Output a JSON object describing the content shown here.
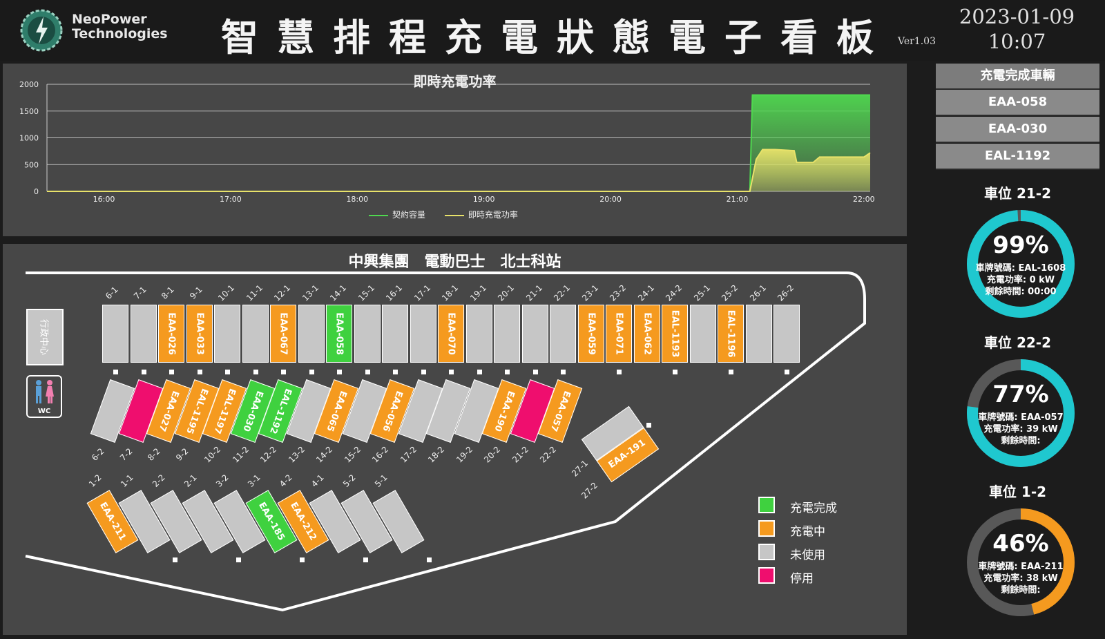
{
  "header": {
    "company_line1": "NeoPower",
    "company_line2": "Technologies",
    "title": "智慧排程充電狀態電子看板",
    "version": "Ver1.03",
    "date": "2023-01-09",
    "time": "10:07"
  },
  "chart_data": {
    "type": "area",
    "title": "即時充電功率",
    "x_ticks": [
      "16:00",
      "17:00",
      "18:00",
      "19:00",
      "20:00",
      "21:00",
      "22:00"
    ],
    "y_ticks": [
      0,
      500,
      1000,
      1500,
      2000
    ],
    "ylim": [
      0,
      2000
    ],
    "xlim_hours": [
      15.55,
      22.05
    ],
    "series": [
      {
        "name": "契約容量",
        "color": "#4fd84f",
        "points": [
          [
            15.55,
            0
          ],
          [
            21.1,
            0
          ],
          [
            21.12,
            1800
          ],
          [
            22.05,
            1800
          ]
        ]
      },
      {
        "name": "即時充電功率",
        "color": "#e8e26a",
        "points": [
          [
            15.55,
            0
          ],
          [
            21.1,
            0
          ],
          [
            21.15,
            600
          ],
          [
            21.2,
            780
          ],
          [
            21.3,
            780
          ],
          [
            21.45,
            760
          ],
          [
            21.47,
            540
          ],
          [
            21.6,
            540
          ],
          [
            21.65,
            640
          ],
          [
            22.0,
            640
          ],
          [
            22.05,
            720
          ]
        ]
      }
    ],
    "legend": "bottom-center"
  },
  "map": {
    "title": "中興集團　電動巴士　北士科站",
    "admin_label": "行政中心",
    "wc_label": "WC",
    "colors": {
      "done": "#3fd13f",
      "charging": "#f59a1f",
      "idle": "#c6c6c6",
      "stopped": "#ef0e6e"
    },
    "top_row": [
      {
        "label": "6-1",
        "plate": "",
        "status": "idle"
      },
      {
        "label": "7-1",
        "plate": "",
        "status": "idle"
      },
      {
        "label": "8-1",
        "plate": "EAA-026",
        "status": "charging"
      },
      {
        "label": "9-1",
        "plate": "EAA-033",
        "status": "charging"
      },
      {
        "label": "10-1",
        "plate": "",
        "status": "idle"
      },
      {
        "label": "11-1",
        "plate": "",
        "status": "idle"
      },
      {
        "label": "12-1",
        "plate": "EAA-067",
        "status": "charging"
      },
      {
        "label": "13-1",
        "plate": "",
        "status": "idle"
      },
      {
        "label": "14-1",
        "plate": "EAA-058",
        "status": "done"
      },
      {
        "label": "15-1",
        "plate": "",
        "status": "idle"
      },
      {
        "label": "16-1",
        "plate": "",
        "status": "idle"
      },
      {
        "label": "17-1",
        "plate": "",
        "status": "idle"
      },
      {
        "label": "18-1",
        "plate": "EAA-070",
        "status": "charging"
      },
      {
        "label": "19-1",
        "plate": "",
        "status": "idle"
      },
      {
        "label": "20-1",
        "plate": "",
        "status": "idle"
      },
      {
        "label": "21-1",
        "plate": "",
        "status": "idle"
      },
      {
        "label": "22-1",
        "plate": "",
        "status": "idle"
      },
      {
        "label": "23-1",
        "plate": "EAA-059",
        "status": "charging"
      },
      {
        "label": "23-2",
        "plate": "EAA-071",
        "status": "charging"
      },
      {
        "label": "24-1",
        "plate": "EAA-062",
        "status": "charging"
      },
      {
        "label": "24-2",
        "plate": "EAL-1193",
        "status": "charging"
      },
      {
        "label": "25-1",
        "plate": "",
        "status": "idle"
      },
      {
        "label": "25-2",
        "plate": "EAL-1196",
        "status": "charging"
      },
      {
        "label": "26-1",
        "plate": "",
        "status": "idle"
      },
      {
        "label": "26-2",
        "plate": "",
        "status": "idle"
      }
    ],
    "mid_row": [
      {
        "label": "6-2",
        "plate": "",
        "status": "idle"
      },
      {
        "label": "7-2",
        "plate": "",
        "status": "stopped"
      },
      {
        "label": "8-2",
        "plate": "EAA-027",
        "status": "charging"
      },
      {
        "label": "9-2",
        "plate": "EAL-1195",
        "status": "charging"
      },
      {
        "label": "10-2",
        "plate": "EAL-1197",
        "status": "charging"
      },
      {
        "label": "11-2",
        "plate": "EAA-030",
        "status": "done"
      },
      {
        "label": "12-2",
        "plate": "EAL-1192",
        "status": "done"
      },
      {
        "label": "13-2",
        "plate": "",
        "status": "idle"
      },
      {
        "label": "14-2",
        "plate": "EAA-065",
        "status": "charging"
      },
      {
        "label": "15-2",
        "plate": "",
        "status": "idle"
      },
      {
        "label": "16-2",
        "plate": "EAA-056",
        "status": "charging"
      },
      {
        "label": "17-2",
        "plate": "",
        "status": "idle"
      },
      {
        "label": "18-2",
        "plate": "",
        "status": "idle"
      },
      {
        "label": "19-2",
        "plate": "",
        "status": "idle"
      },
      {
        "label": "20-2",
        "plate": "EAA-190",
        "status": "charging"
      },
      {
        "label": "21-2",
        "plate": "",
        "status": "stopped"
      },
      {
        "label": "22-2",
        "plate": "EAA-057",
        "status": "charging"
      }
    ],
    "bottom_row": [
      {
        "label": "1-2",
        "plate": "EAA-211",
        "status": "charging"
      },
      {
        "label": "1-1",
        "plate": "",
        "status": "idle"
      },
      {
        "label": "2-2",
        "plate": "",
        "status": "idle"
      },
      {
        "label": "2-1",
        "plate": "",
        "status": "idle"
      },
      {
        "label": "3-2",
        "plate": "",
        "status": "idle"
      },
      {
        "label": "3-1",
        "plate": "EAA-185",
        "status": "done"
      },
      {
        "label": "4-2",
        "plate": "EAA-212",
        "status": "charging"
      },
      {
        "label": "4-1",
        "plate": "",
        "status": "idle"
      },
      {
        "label": "5-2",
        "plate": "",
        "status": "idle"
      },
      {
        "label": "5-1",
        "plate": "",
        "status": "idle"
      }
    ],
    "slot27": [
      {
        "label": "27-1",
        "plate": "",
        "status": "idle"
      },
      {
        "label": "27-2",
        "plate": "EAA-191",
        "status": "charging"
      }
    ],
    "legend": [
      {
        "label": "充電完成",
        "status": "done"
      },
      {
        "label": "充電中",
        "status": "charging"
      },
      {
        "label": "未使用",
        "status": "idle"
      },
      {
        "label": "停用",
        "status": "stopped"
      }
    ]
  },
  "completed": {
    "title": "充電完成車輛",
    "vehicles": [
      "EAA-058",
      "EAA-030",
      "EAL-1192"
    ]
  },
  "gauges": [
    {
      "title": "車位 21-2",
      "percent_text": "99%",
      "percent": 0.99,
      "color": "#1fc8cf",
      "plate": "車牌號碼: EAL-1608",
      "power": "充電功率: 0 kW",
      "remaining": "剩餘時間: 00:00"
    },
    {
      "title": "車位 22-2",
      "percent_text": "77%",
      "percent": 0.77,
      "color": "#1fc8cf",
      "plate": "車牌號碼: EAA-057",
      "power": "充電功率: 39 kW",
      "remaining": "剩餘時間:"
    },
    {
      "title": "車位 1-2",
      "percent_text": "46%",
      "percent": 0.46,
      "color": "#f59a1f",
      "plate": "車牌號碼: EAA-211",
      "power": "充電功率: 38 kW",
      "remaining": "剩餘時間:"
    }
  ]
}
